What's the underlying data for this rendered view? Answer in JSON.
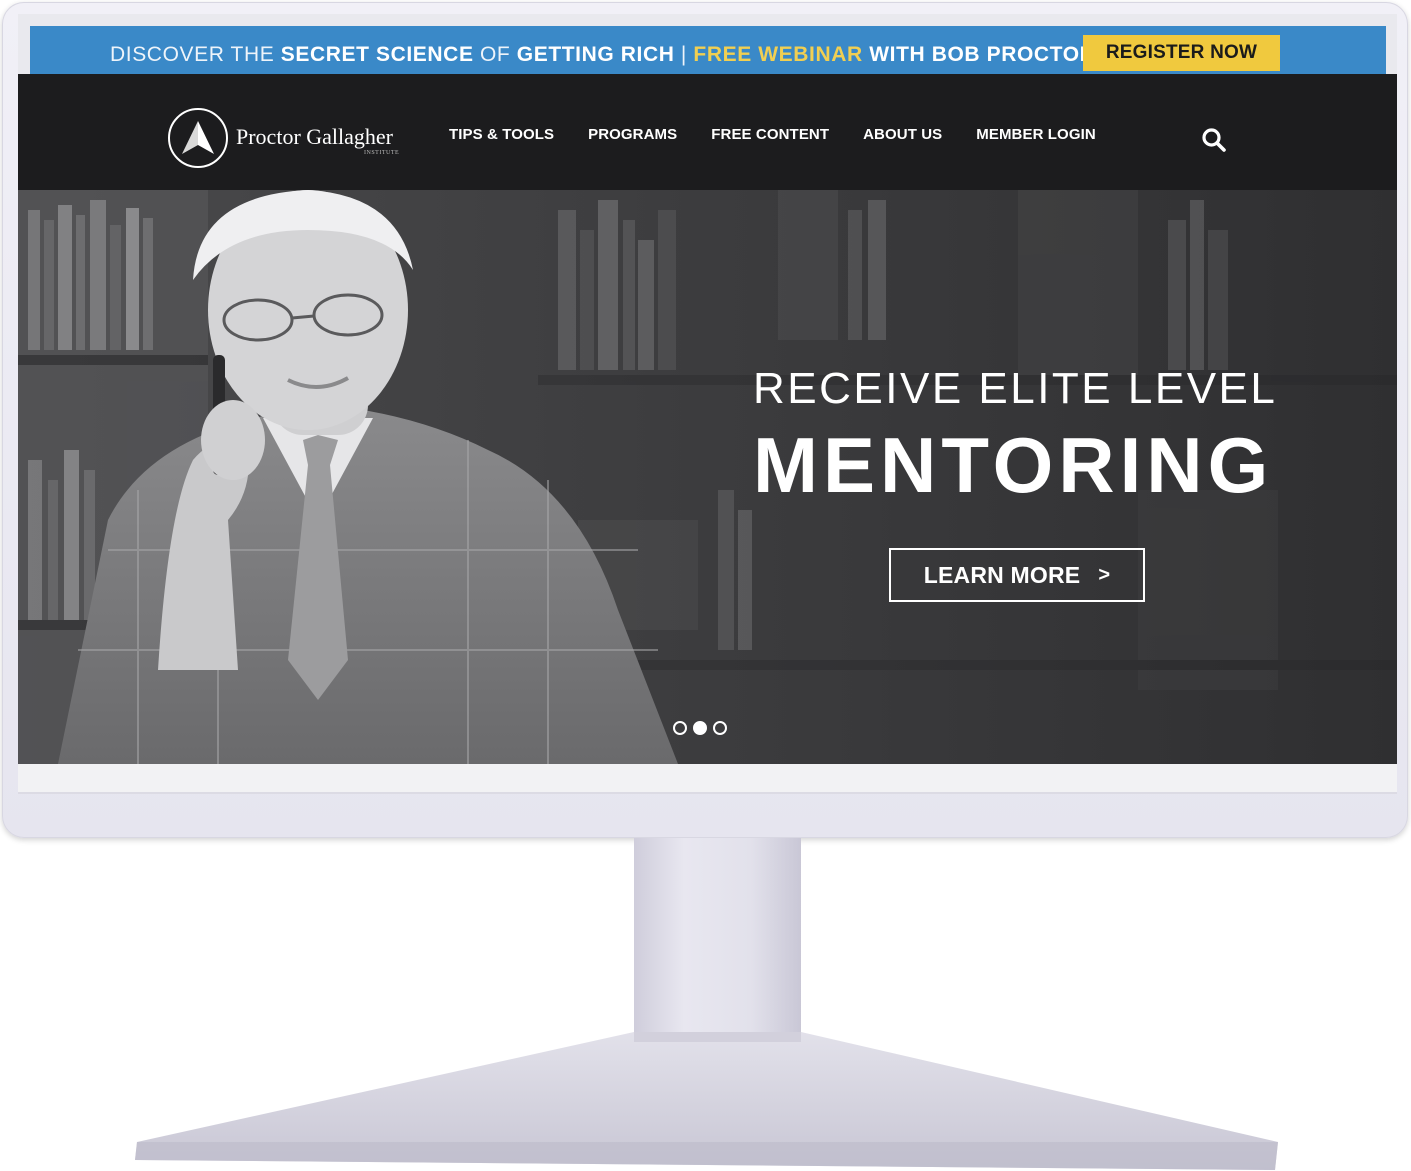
{
  "promo": {
    "part1": "DISCOVER THE ",
    "part2": "SECRET SCIENCE",
    "part3": " OF ",
    "part4": "GETTING RICH",
    "part5": " | ",
    "part6": "FREE WEBINAR",
    "part7": " WITH BOB PROCTOR",
    "register_label": "REGISTER NOW",
    "bar_color": "#3a89c8",
    "button_color": "#f0c93e",
    "highlight_color": "#f1cf52"
  },
  "nav": {
    "logo_name": "Proctor Gallagher",
    "logo_sub": "INSTITUTE",
    "links": [
      "TIPS & TOOLS",
      "PROGRAMS",
      "FREE CONTENT",
      "ABOUT US",
      "MEMBER LOGIN"
    ],
    "search_icon": "search-icon"
  },
  "hero": {
    "line1": "RECEIVE ELITE LEVEL",
    "line2": "MENTORING",
    "cta_label": "LEARN MORE",
    "cta_arrow": ">",
    "carousel_slide_count": 3,
    "carousel_active_index": 1
  }
}
